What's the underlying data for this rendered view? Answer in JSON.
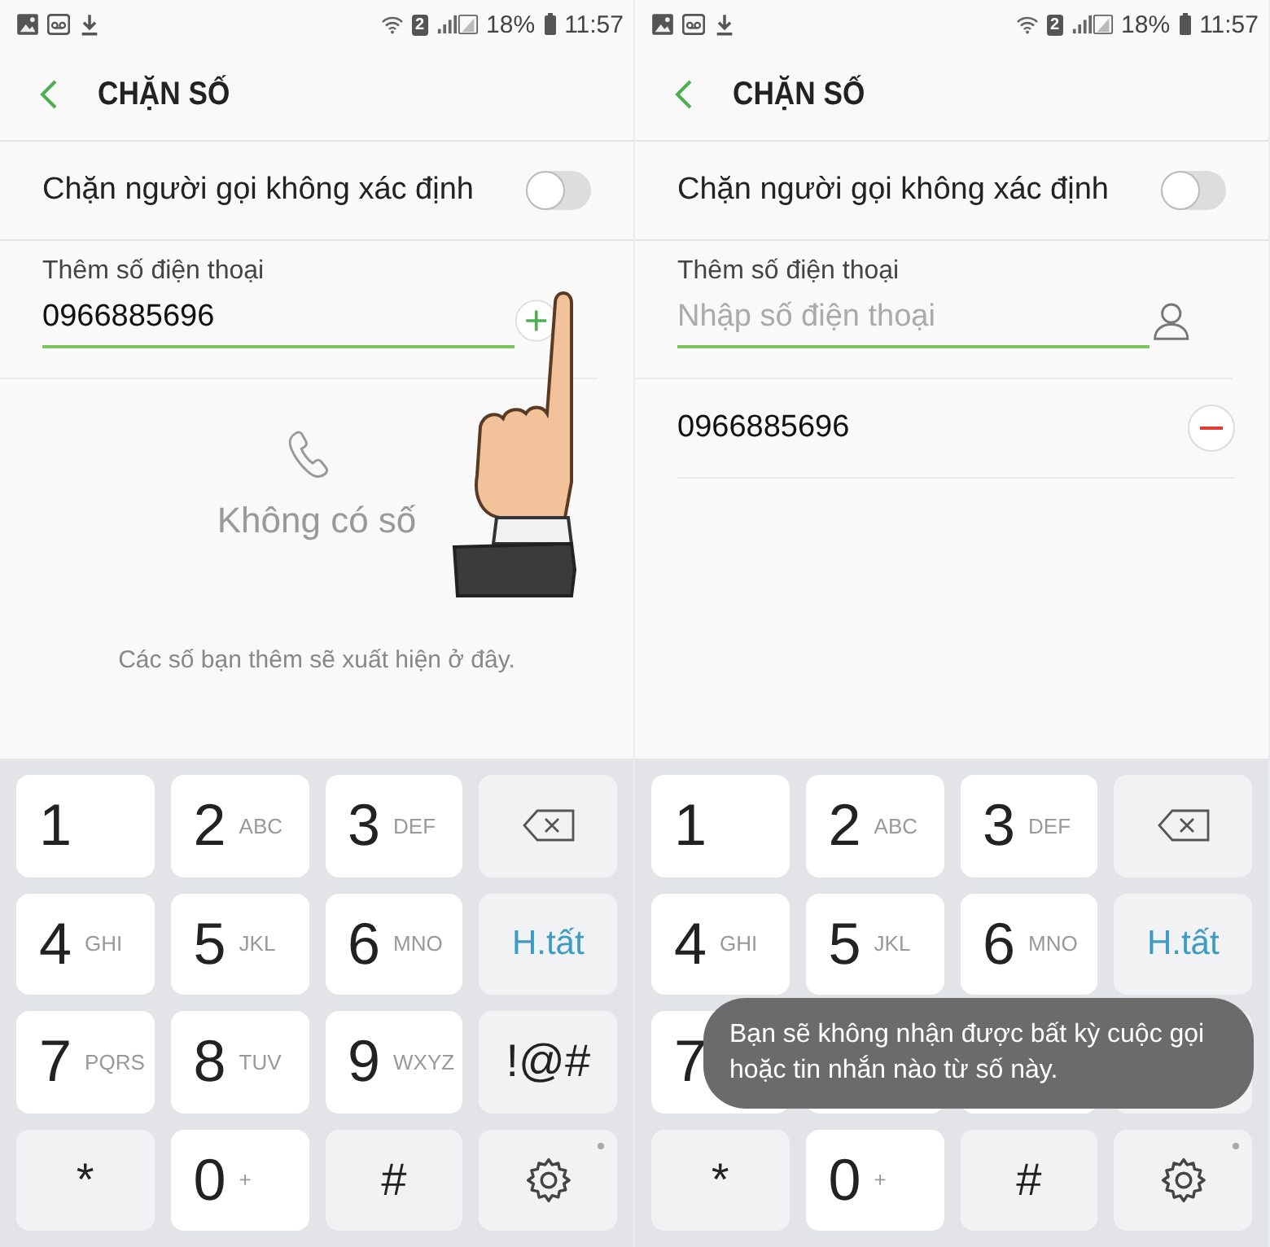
{
  "screens": [
    {
      "status_bar": {
        "sim": "2",
        "battery": "18%",
        "time": "11:57"
      },
      "header": {
        "title": "CHẶN SỐ"
      },
      "setting": {
        "label": "Chặn người gọi không xác định",
        "on": false
      },
      "add_field": {
        "label": "Thêm số điện thoại",
        "value": "0966885696",
        "kind": "add"
      },
      "pointer_hand": true,
      "empty_state": {
        "title": "Không có số",
        "hint": "Các số bạn thêm sẽ xuất hiện ở đây."
      },
      "keypad": [
        {
          "kind": "digit",
          "main": "1"
        },
        {
          "kind": "digit",
          "main": "2",
          "sub": "ABC"
        },
        {
          "kind": "digit",
          "main": "3",
          "sub": "DEF"
        },
        {
          "kind": "backspace"
        },
        {
          "kind": "digit",
          "main": "4",
          "sub": "GHI"
        },
        {
          "kind": "digit",
          "main": "5",
          "sub": "JKL"
        },
        {
          "kind": "digit",
          "main": "6",
          "sub": "MNO"
        },
        {
          "kind": "clear",
          "main": "H.tất"
        },
        {
          "kind": "digit",
          "main": "7",
          "sub": "PQRS"
        },
        {
          "kind": "digit",
          "main": "8",
          "sub": "TUV"
        },
        {
          "kind": "digit",
          "main": "9",
          "sub": "WXYZ"
        },
        {
          "kind": "symbol",
          "main": "!@#"
        },
        {
          "kind": "symbol",
          "main": "*"
        },
        {
          "kind": "digit",
          "main": "0",
          "sub": "+"
        },
        {
          "kind": "symbol",
          "main": "#"
        },
        {
          "kind": "settings"
        }
      ]
    },
    {
      "status_bar": {
        "sim": "2",
        "battery": "18%",
        "time": "11:57"
      },
      "header": {
        "title": "CHẶN SỐ"
      },
      "setting": {
        "label": "Chặn người gọi không xác định",
        "on": false
      },
      "add_field": {
        "label": "Thêm số điện thoại",
        "placeholder": "Nhập số điện thoại",
        "kind": "contact"
      },
      "pointer_hand": false,
      "blocked": [
        {
          "number": "0966885696"
        }
      ],
      "keypad": [
        {
          "kind": "digit",
          "main": "1"
        },
        {
          "kind": "digit",
          "main": "2",
          "sub": "ABC"
        },
        {
          "kind": "digit",
          "main": "3",
          "sub": "DEF"
        },
        {
          "kind": "backspace"
        },
        {
          "kind": "digit",
          "main": "4",
          "sub": "GHI"
        },
        {
          "kind": "digit",
          "main": "5",
          "sub": "JKL"
        },
        {
          "kind": "digit",
          "main": "6",
          "sub": "MNO"
        },
        {
          "kind": "clear",
          "main": "H.tất"
        },
        {
          "kind": "digit",
          "main": "7"
        },
        {
          "kind": "digit"
        },
        {
          "kind": "digit"
        },
        {
          "kind": "symbol"
        },
        {
          "kind": "symbol",
          "main": "*"
        },
        {
          "kind": "digit",
          "main": "0",
          "sub": "+"
        },
        {
          "kind": "symbol",
          "main": "#"
        },
        {
          "kind": "settings"
        }
      ],
      "toast": "Bạn sẽ không nhận được bất kỳ cuộc gọi hoặc tin nhắn nào từ số này."
    }
  ]
}
